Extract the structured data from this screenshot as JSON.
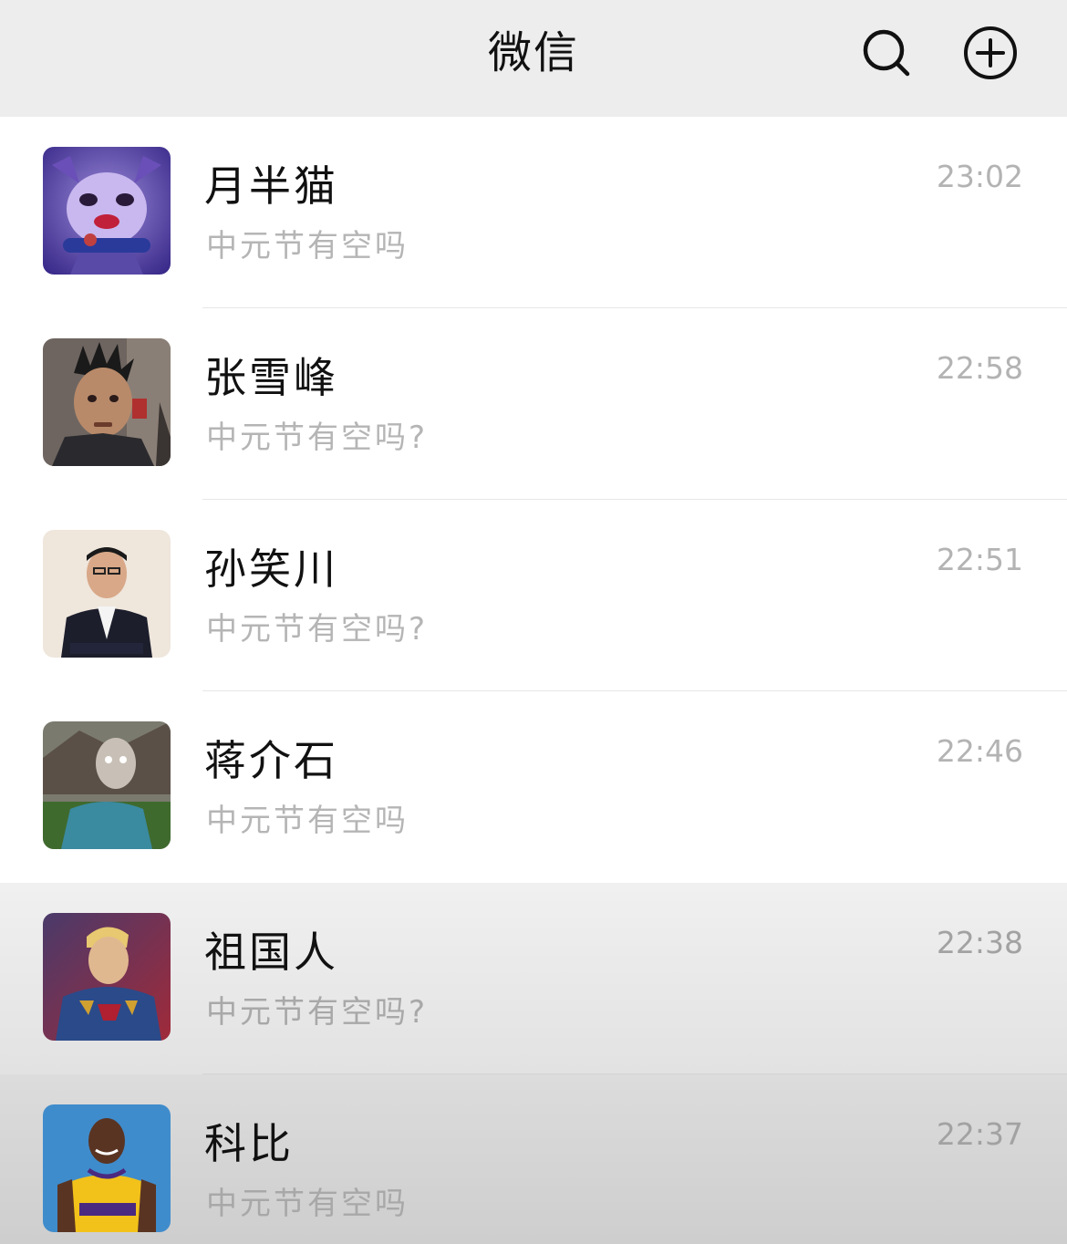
{
  "header": {
    "title": "微信",
    "search_icon": "search-icon",
    "add_icon": "plus-circle-icon"
  },
  "chats": [
    {
      "name": "月半猫",
      "message": "中元节有空吗",
      "time": "23:02"
    },
    {
      "name": "张雪峰",
      "message": "中元节有空吗?",
      "time": "22:58"
    },
    {
      "name": "孙笑川",
      "message": "中元节有空吗?",
      "time": "22:51"
    },
    {
      "name": "蒋介石",
      "message": "中元节有空吗",
      "time": "22:46"
    },
    {
      "name": "祖国人",
      "message": "中元节有空吗?",
      "time": "22:38"
    },
    {
      "name": "科比",
      "message": "中元节有空吗",
      "time": "22:37"
    }
  ],
  "colors": {
    "topbar_bg": "#ededed",
    "name_text": "#111111",
    "message_text": "#b5b5b5",
    "time_text": "#b3b3b3"
  }
}
